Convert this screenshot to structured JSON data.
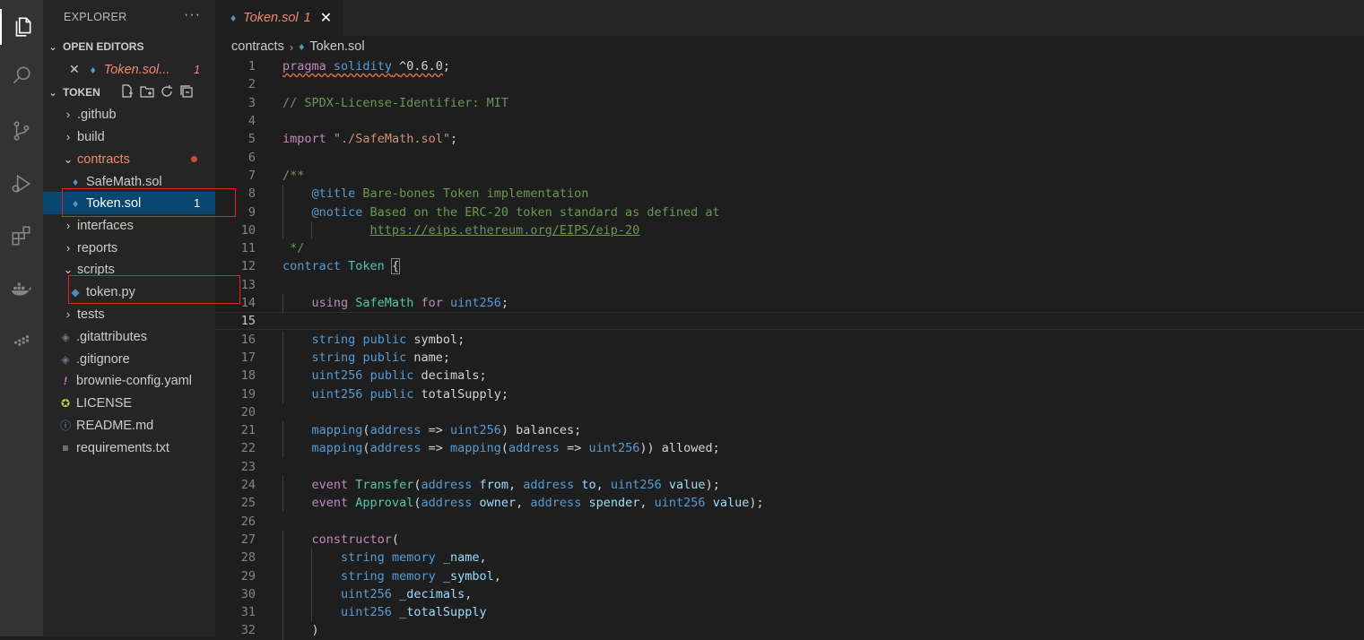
{
  "sidebar": {
    "title": "EXPLORER",
    "more": "···",
    "open_editors": {
      "header": "OPEN EDITORS",
      "item_name": "Token.sol...",
      "item_badge": "1"
    },
    "project": {
      "header": "TOKEN"
    },
    "tree": [
      {
        "label": ".github",
        "kind": "folder",
        "chevron": "›"
      },
      {
        "label": "build",
        "kind": "folder",
        "chevron": "›"
      },
      {
        "label": "contracts",
        "kind": "folder-open",
        "chevron": "⌄"
      },
      {
        "label": "SafeMath.sol",
        "kind": "sol"
      },
      {
        "label": "Token.sol",
        "kind": "sol",
        "badge": "1"
      },
      {
        "label": "interfaces",
        "kind": "folder",
        "chevron": "›"
      },
      {
        "label": "reports",
        "kind": "folder",
        "chevron": "›"
      },
      {
        "label": "scripts",
        "kind": "folder-open",
        "chevron": "⌄"
      },
      {
        "label": "token.py",
        "kind": "py"
      },
      {
        "label": "tests",
        "kind": "folder",
        "chevron": "›"
      },
      {
        "label": ".gitattributes",
        "kind": "git"
      },
      {
        "label": ".gitignore",
        "kind": "git"
      },
      {
        "label": "brownie-config.yaml",
        "kind": "yaml"
      },
      {
        "label": "LICENSE",
        "kind": "license"
      },
      {
        "label": "README.md",
        "kind": "info"
      },
      {
        "label": "requirements.txt",
        "kind": "text"
      }
    ]
  },
  "tab": {
    "name": "Token.sol",
    "badge": "1"
  },
  "breadcrumb": {
    "folder": "contracts",
    "file": "Token.sol"
  },
  "colors": {
    "accent": "#094771",
    "error": "#f48771",
    "highlight_box": "#e0241d"
  },
  "code": {
    "current_line": 15,
    "lines": [
      "pragma solidity ^0.6.0;",
      "",
      "// SPDX-License-Identifier: MIT",
      "",
      "import \"./SafeMath.sol\";",
      "",
      "/**",
      "    @title Bare-bones Token implementation",
      "    @notice Based on the ERC-20 token standard as defined at",
      "            https://eips.ethereum.org/EIPS/eip-20",
      " */",
      "contract Token {",
      "",
      "    using SafeMath for uint256;",
      "",
      "    string public symbol;",
      "    string public name;",
      "    uint256 public decimals;",
      "    uint256 public totalSupply;",
      "",
      "    mapping(address => uint256) balances;",
      "    mapping(address => mapping(address => uint256)) allowed;",
      "",
      "    event Transfer(address from, address to, uint256 value);",
      "    event Approval(address owner, address spender, uint256 value);",
      "",
      "    constructor(",
      "        string memory _name,",
      "        string memory _symbol,",
      "        uint256 _decimals,",
      "        uint256 _totalSupply",
      "    )"
    ]
  }
}
